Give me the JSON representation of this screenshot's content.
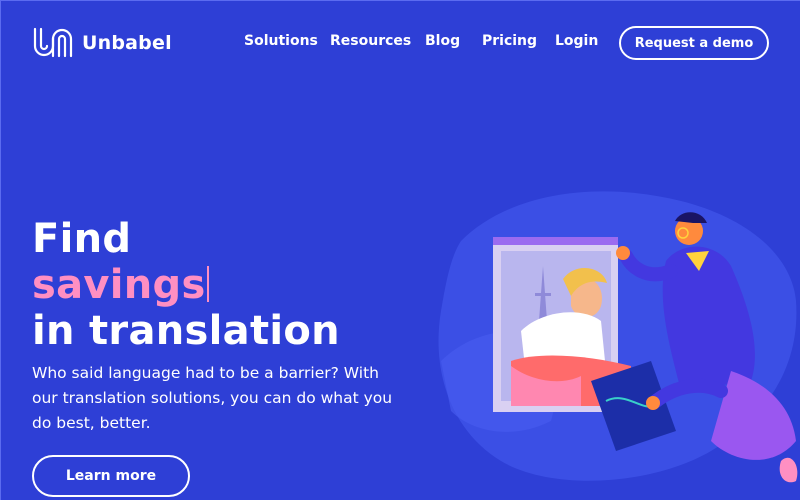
{
  "header": {
    "brand": "Unbabel",
    "nav": {
      "solutions": "Solutions",
      "resources": "Resources",
      "blog": "Blog",
      "pricing": "Pricing",
      "login": "Login"
    },
    "cta": "Request a demo"
  },
  "hero": {
    "title_line1": "Find",
    "title_line2": "savings",
    "title_line3": "in translation",
    "subtitle": "Who said language had to be a barrier? With our translation solutions, you can do what you do best, better.",
    "button": "Learn more"
  },
  "colors": {
    "background": "#2e3fd6",
    "accent": "#ff8fc2",
    "text": "#ffffff"
  },
  "icons": {
    "logo": "unbabel-logo-icon"
  }
}
